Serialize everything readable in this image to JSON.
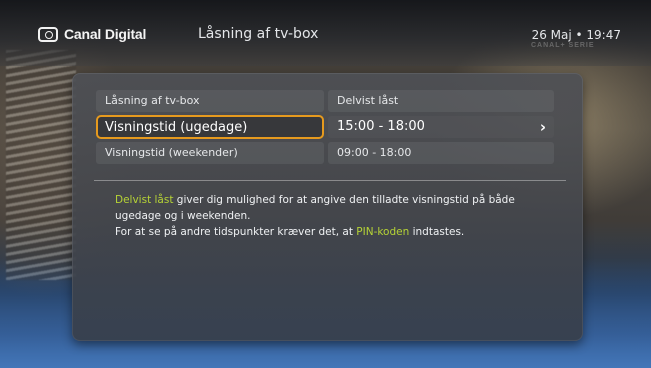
{
  "header": {
    "brand": "Canal Digital",
    "title": "Låsning af tv-box",
    "clock": "26 Maj • 19:47",
    "watermark": "CANAL+ SERIE"
  },
  "menu": {
    "rows": [
      {
        "label": "Låsning af tv-box",
        "value": "Delvist låst"
      },
      {
        "label": "Visningstid (ugedage)",
        "value": "15:00 - 18:00",
        "selected": true
      },
      {
        "label": "Visningstid (weekender)",
        "value": "09:00 - 18:00"
      }
    ],
    "chevron": "›"
  },
  "info": {
    "line1_hl": "Delvist låst",
    "line1_rest": " giver dig mulighed for at angive den tilladte visningstid på både ugedage og i weekenden.",
    "line2_pre": "For at se på andre tidspunkter kræver det, at ",
    "line2_hl": "PIN-koden",
    "line2_post": " indtastes."
  },
  "colors": {
    "focus": "#e69a1e",
    "highlight": "#b6d336"
  },
  "icons": {
    "brand": "canal-digital-logo-icon",
    "arrow": "chevron-right-icon"
  }
}
